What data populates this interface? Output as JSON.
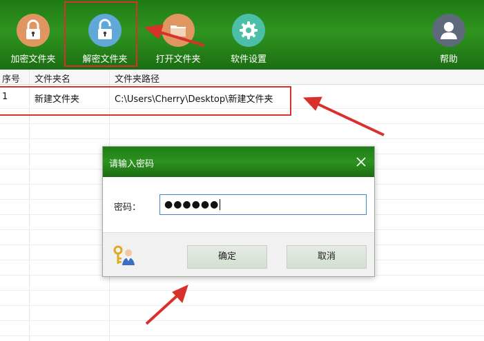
{
  "toolbar": {
    "items": [
      {
        "label": "加密文件夹",
        "icon": "lock-icon",
        "color": "#e09660"
      },
      {
        "label": "解密文件夹",
        "icon": "unlock-icon",
        "color": "#5fa8d8"
      },
      {
        "label": "打开文件夹",
        "icon": "folder-icon",
        "color": "#e09660"
      },
      {
        "label": "软件设置",
        "icon": "gear-icon",
        "color": "#4cbfa8"
      },
      {
        "label": "帮助",
        "icon": "user-help-icon",
        "color": "#5e6a7c"
      }
    ],
    "background": "#2a8c1c"
  },
  "table": {
    "columns": [
      "序号",
      "文件夹名",
      "文件夹路径"
    ],
    "rows": [
      {
        "index": "1",
        "name": "新建文件夹",
        "path": "C:\\Users\\Cherry\\Desktop\\新建文件夹"
      }
    ]
  },
  "dialog": {
    "title": "请输入密码",
    "password_label": "密码：",
    "password_value": "●●●●●●",
    "ok_label": "确定",
    "cancel_label": "取消"
  },
  "annotation_color": "#d9302c"
}
